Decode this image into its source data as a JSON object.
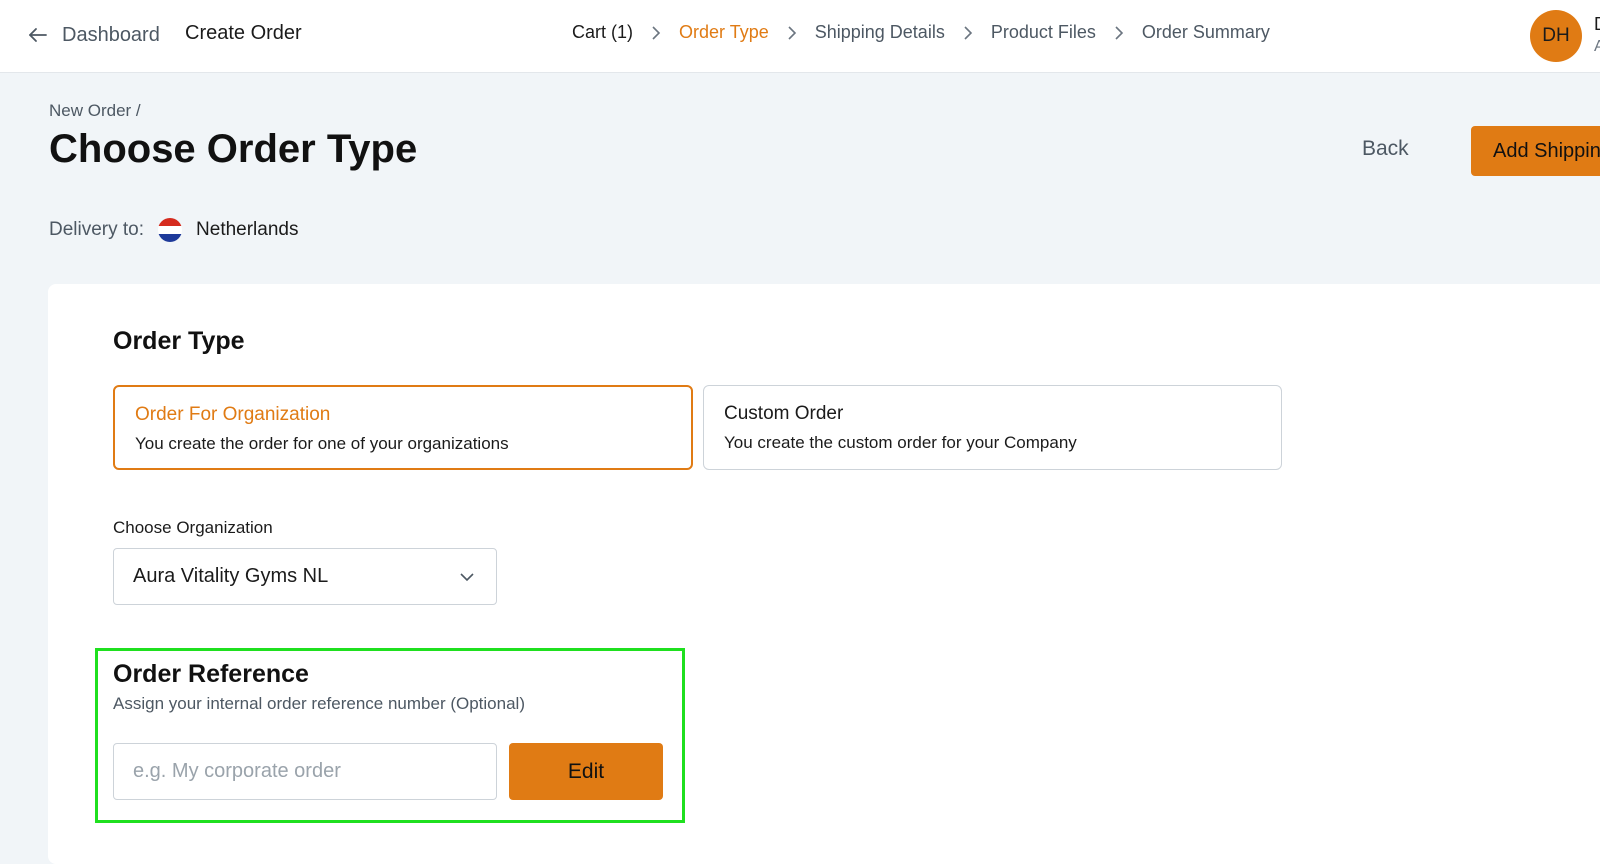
{
  "header": {
    "back_label": "Dashboard",
    "title": "Create Order",
    "steps": [
      {
        "label": "Cart (1)"
      },
      {
        "label": "Order Type"
      },
      {
        "label": "Shipping Details"
      },
      {
        "label": "Product Files"
      },
      {
        "label": "Order Summary"
      }
    ],
    "active_step": "Order Type",
    "user": {
      "initials": "DH",
      "name": "D",
      "sub": "A"
    }
  },
  "page": {
    "breadcrumb": "New Order /",
    "title": "Choose Order Type",
    "back_button": "Back",
    "primary_button": "Add Shipping",
    "delivery_label": "Delivery to:",
    "delivery_country": "Netherlands"
  },
  "order_type": {
    "title": "Order Type",
    "options": [
      {
        "title": "Order For Organization",
        "description": "You create the order for one of your organizations",
        "selected": true
      },
      {
        "title": "Custom Order",
        "description": "You create the custom order for your Company",
        "selected": false
      }
    ]
  },
  "organization": {
    "label": "Choose Organization",
    "value": "Aura Vitality Gyms NL"
  },
  "order_reference": {
    "title": "Order Reference",
    "subtitle": "Assign your internal order reference number (Optional)",
    "placeholder": "e.g. My corporate order",
    "value": "",
    "edit_button": "Edit"
  },
  "colors": {
    "accent": "#e07b14",
    "highlight_border": "#1fe01f",
    "background": "#f1f5f8"
  }
}
